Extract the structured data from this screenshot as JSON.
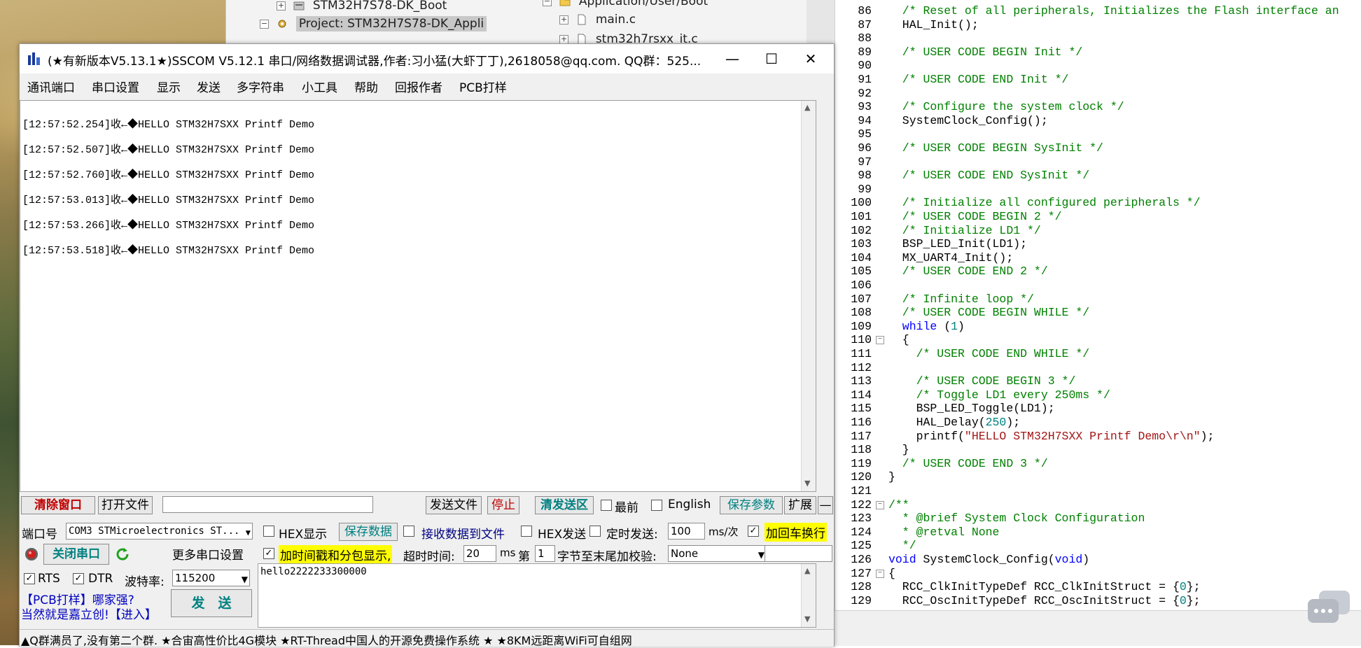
{
  "tree": {
    "items": [
      {
        "label": "STM32H7S78-DK_Boot"
      },
      {
        "label": "Project: STM32H7S78-DK_Appli"
      },
      {
        "label": "Application/User/Boot"
      },
      {
        "label": "main.c"
      },
      {
        "label": "stm32h7rsxx_it.c"
      }
    ]
  },
  "sscom": {
    "title": "(★有新版本V5.13.1★)SSCOM V5.12.1 串口/网络数据调试器,作者:习小猛(大虾丁丁),2618058@qq.com. QQ群：525...",
    "window_minimize": "—",
    "window_maximize": "☐",
    "window_close": "✕",
    "menu": [
      "通讯端口",
      "串口设置",
      "显示",
      "发送",
      "多字符串",
      "小工具",
      "帮助",
      "回报作者",
      "PCB打样"
    ],
    "receive_lines": [
      "[12:57:52.254]收←◆HELLO STM32H7SXX Printf Demo",
      "[12:57:52.507]收←◆HELLO STM32H7SXX Printf Demo",
      "[12:57:52.760]收←◆HELLO STM32H7SXX Printf Demo",
      "[12:57:53.013]收←◆HELLO STM32H7SXX Printf Demo",
      "[12:57:53.266]收←◆HELLO STM32H7SXX Printf Demo",
      "[12:57:53.518]收←◆HELLO STM32H7SXX Printf Demo"
    ],
    "toolbar": {
      "clear": "清除窗口",
      "open_file": "打开文件",
      "file_path": "",
      "send_file": "发送文件",
      "stop": "停止",
      "clear_send": "清发送区",
      "topmost": "最前",
      "english": "English",
      "save_params": "保存参数",
      "expand": "扩展",
      "collapse": "—"
    },
    "port_label": "端口号",
    "port_value": "COM3 STMicroelectronics ST...",
    "close_port": "关闭串口",
    "more_settings": "更多串口设置",
    "rts": "RTS",
    "dtr": "DTR",
    "baud_label": "波特率:",
    "baud_value": "115200",
    "hex_display": "HEX显示",
    "save_data": "保存数据",
    "recv_to_file": "接收数据到文件",
    "timestamp": "加时间戳和分包显示,",
    "timeout_label": "超时时间:",
    "timeout_value": "20",
    "ms": "ms",
    "hex_send": "HEX发送",
    "timed_send": "定时发送:",
    "period_value": "100",
    "period_unit": "ms/次",
    "add_crlf": "加回车换行",
    "nth_label": "第",
    "nth_value": "1",
    "checksum_label": "字节至末尾加校验:",
    "checksum_value": "None",
    "checksum_extra": "",
    "send_text": "hello2222233300000",
    "pcb_ad1": "【PCB打样】哪家强?",
    "pcb_ad2": "当然就是嘉立创!【进入】",
    "send_button": "发　送",
    "status_text": "▲Q群满员了,没有第二个群. ★合宙高性价比4G模块 ★RT-Thread中国人的开源免费操作系统 ★ ★8KM远距离WiFi可自组网"
  },
  "editor": {
    "lines": [
      {
        "n": "86",
        "segs": [
          [
            "cmt",
            "  /* Reset of all peripherals, Initializes the Flash interface an"
          ]
        ]
      },
      {
        "n": "87",
        "segs": [
          [
            "txt",
            "  HAL_Init();"
          ]
        ]
      },
      {
        "n": "88",
        "segs": [
          [
            "txt",
            ""
          ]
        ]
      },
      {
        "n": "89",
        "segs": [
          [
            "cmt",
            "  /* USER CODE BEGIN Init */"
          ]
        ]
      },
      {
        "n": "90",
        "segs": [
          [
            "txt",
            ""
          ]
        ]
      },
      {
        "n": "91",
        "segs": [
          [
            "cmt",
            "  /* USER CODE END Init */"
          ]
        ]
      },
      {
        "n": "92",
        "segs": [
          [
            "txt",
            ""
          ]
        ]
      },
      {
        "n": "93",
        "segs": [
          [
            "cmt",
            "  /* Configure the system clock */"
          ]
        ]
      },
      {
        "n": "94",
        "segs": [
          [
            "txt",
            "  SystemClock_Config();"
          ]
        ]
      },
      {
        "n": "95",
        "segs": [
          [
            "txt",
            ""
          ]
        ]
      },
      {
        "n": "96",
        "segs": [
          [
            "cmt",
            "  /* USER CODE BEGIN SysInit */"
          ]
        ]
      },
      {
        "n": "97",
        "segs": [
          [
            "txt",
            ""
          ]
        ]
      },
      {
        "n": "98",
        "segs": [
          [
            "cmt",
            "  /* USER CODE END SysInit */"
          ]
        ]
      },
      {
        "n": "99",
        "segs": [
          [
            "txt",
            ""
          ]
        ]
      },
      {
        "n": "100",
        "segs": [
          [
            "cmt",
            "  /* Initialize all configured peripherals */"
          ]
        ]
      },
      {
        "n": "101",
        "segs": [
          [
            "cmt",
            "  /* USER CODE BEGIN 2 */"
          ]
        ]
      },
      {
        "n": "102",
        "segs": [
          [
            "cmt",
            "  /* Initialize LD1 */"
          ]
        ]
      },
      {
        "n": "103",
        "segs": [
          [
            "txt",
            "  BSP_LED_Init(LD1);"
          ]
        ]
      },
      {
        "n": "104",
        "segs": [
          [
            "txt",
            "  MX_UART4_Init();"
          ]
        ]
      },
      {
        "n": "105",
        "segs": [
          [
            "cmt",
            "  /* USER CODE END 2 */"
          ]
        ]
      },
      {
        "n": "106",
        "segs": [
          [
            "txt",
            ""
          ]
        ]
      },
      {
        "n": "107",
        "segs": [
          [
            "cmt",
            "  /* Infinite loop */"
          ]
        ]
      },
      {
        "n": "108",
        "segs": [
          [
            "cmt",
            "  /* USER CODE BEGIN WHILE */"
          ]
        ]
      },
      {
        "n": "109",
        "segs": [
          [
            "kw",
            "  while"
          ],
          [
            "txt",
            " ("
          ],
          [
            "num",
            "1"
          ],
          [
            "txt",
            ")"
          ]
        ]
      },
      {
        "n": "110",
        "segs": [
          [
            "txt",
            "  {"
          ]
        ],
        "fold": "−"
      },
      {
        "n": "111",
        "segs": [
          [
            "cmt",
            "    /* USER CODE END WHILE */"
          ]
        ]
      },
      {
        "n": "112",
        "segs": [
          [
            "txt",
            ""
          ]
        ]
      },
      {
        "n": "113",
        "segs": [
          [
            "cmt",
            "    /* USER CODE BEGIN 3 */"
          ]
        ]
      },
      {
        "n": "114",
        "segs": [
          [
            "cmt",
            "    /* Toggle LD1 every 250ms */"
          ]
        ]
      },
      {
        "n": "115",
        "segs": [
          [
            "txt",
            "    BSP_LED_Toggle(LD1);"
          ]
        ]
      },
      {
        "n": "116",
        "segs": [
          [
            "txt",
            "    HAL_Delay("
          ],
          [
            "num",
            "250"
          ],
          [
            "txt",
            ");"
          ]
        ]
      },
      {
        "n": "117",
        "segs": [
          [
            "txt",
            "    printf("
          ],
          [
            "str",
            "\"HELLO STM32H7SXX Printf Demo\\r\\n\""
          ],
          [
            "txt",
            ");"
          ]
        ]
      },
      {
        "n": "118",
        "segs": [
          [
            "txt",
            "  }"
          ]
        ]
      },
      {
        "n": "119",
        "segs": [
          [
            "cmt",
            "  /* USER CODE END 3 */"
          ]
        ]
      },
      {
        "n": "120",
        "segs": [
          [
            "txt",
            "}"
          ]
        ]
      },
      {
        "n": "121",
        "segs": [
          [
            "txt",
            ""
          ]
        ]
      },
      {
        "n": "122",
        "segs": [
          [
            "cmt",
            "/**"
          ]
        ],
        "fold": "−"
      },
      {
        "n": "123",
        "segs": [
          [
            "cmt",
            "  * @brief System Clock Configuration"
          ]
        ]
      },
      {
        "n": "124",
        "segs": [
          [
            "cmt",
            "  * @retval None"
          ]
        ]
      },
      {
        "n": "125",
        "segs": [
          [
            "cmt",
            "  */"
          ]
        ]
      },
      {
        "n": "126",
        "segs": [
          [
            "kw",
            "void"
          ],
          [
            "txt",
            " SystemClock_Config("
          ],
          [
            "kw",
            "void"
          ],
          [
            "txt",
            ")"
          ]
        ]
      },
      {
        "n": "127",
        "segs": [
          [
            "txt",
            "{"
          ]
        ],
        "fold": "−"
      },
      {
        "n": "128",
        "segs": [
          [
            "txt",
            "  RCC_ClkInitTypeDef RCC_ClkInitStruct = {"
          ],
          [
            "num",
            "0"
          ],
          [
            "txt",
            "};"
          ]
        ]
      },
      {
        "n": "129",
        "segs": [
          [
            "txt",
            "  RCC_OscInitTypeDef RCC_OscInitStruct = {"
          ],
          [
            "num",
            "0"
          ],
          [
            "txt",
            "};"
          ]
        ]
      }
    ]
  },
  "colors": {
    "comment": "#008000",
    "keyword": "#0000ff",
    "string": "#a31515",
    "number": "#008080",
    "highlight_yellow": "#ffff00",
    "button_red": "#c00000",
    "button_teal": "#008080"
  }
}
